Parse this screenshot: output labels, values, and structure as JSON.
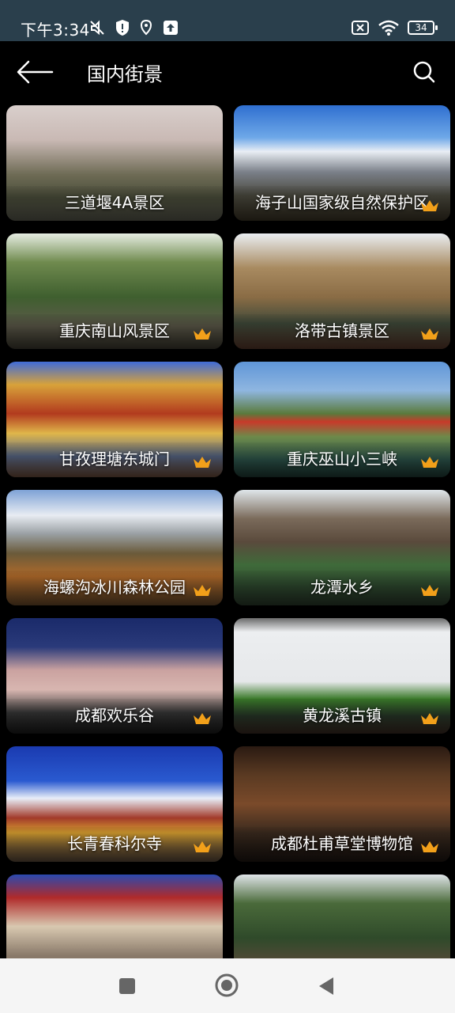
{
  "status": {
    "time": "下午3:34",
    "battery": "34"
  },
  "appbar": {
    "title": "国内街景"
  },
  "colors": {
    "crown": "#f2a01a",
    "statusbar": "#2a3f4c"
  },
  "attractions": [
    {
      "name": "三道堰4A景区",
      "vip": false
    },
    {
      "name": "海子山国家级自然保护区",
      "vip": true
    },
    {
      "name": "重庆南山风景区",
      "vip": true
    },
    {
      "name": "洛带古镇景区",
      "vip": true
    },
    {
      "name": "甘孜理塘东城门",
      "vip": true
    },
    {
      "name": "重庆巫山小三峡",
      "vip": true
    },
    {
      "name": "海螺沟冰川森林公园",
      "vip": true
    },
    {
      "name": "龙潭水乡",
      "vip": true
    },
    {
      "name": "成都欢乐谷",
      "vip": true
    },
    {
      "name": "黄龙溪古镇",
      "vip": true
    },
    {
      "name": "长青春科尔寺",
      "vip": true
    },
    {
      "name": "成都杜甫草堂博物馆",
      "vip": true
    },
    {
      "name": "",
      "vip": false
    },
    {
      "name": "",
      "vip": false
    }
  ]
}
